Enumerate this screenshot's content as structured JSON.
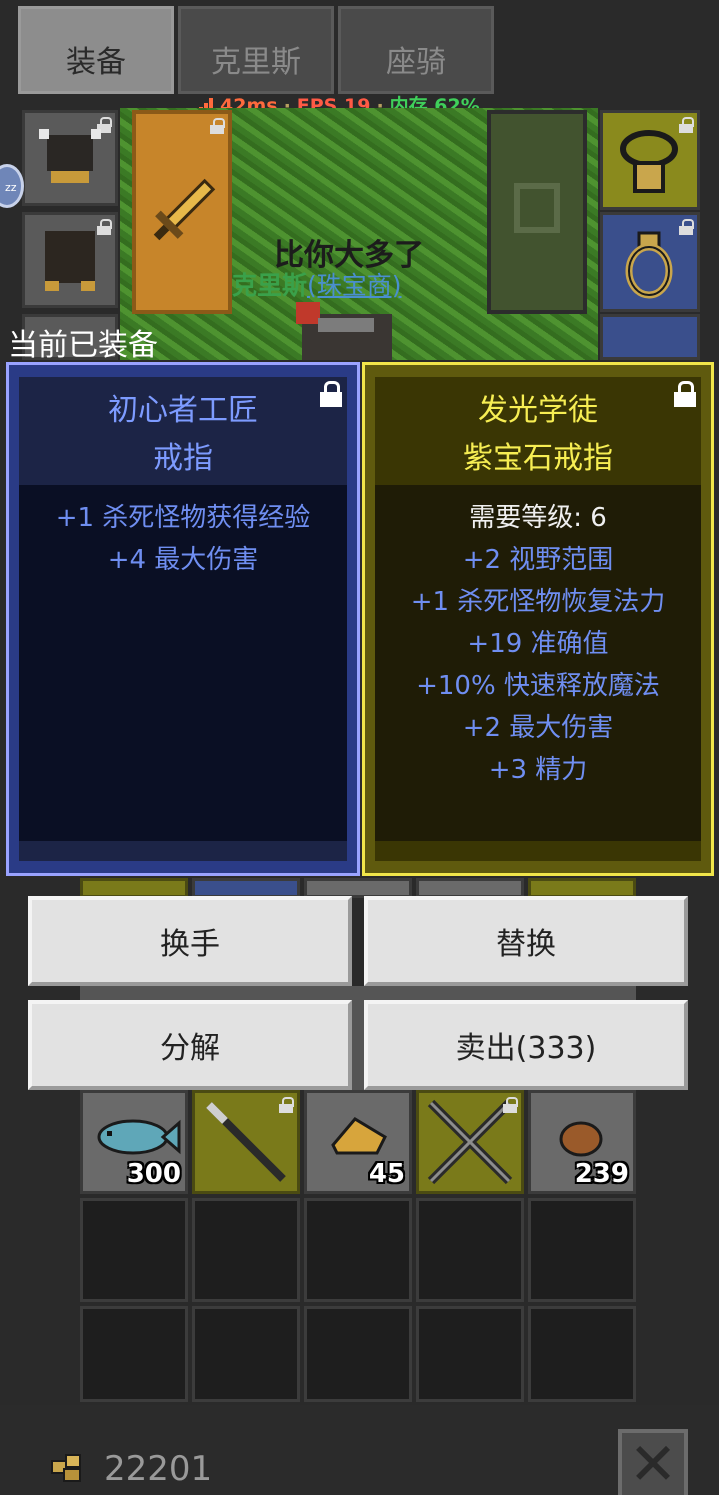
{
  "tabs": [
    {
      "label": "装备",
      "active": true
    },
    {
      "label": "克里斯",
      "active": false
    },
    {
      "label": "座骑",
      "active": false
    }
  ],
  "perf": {
    "ping": "42ms",
    "fps": "FPS 19",
    "mem": "内存 62%"
  },
  "scene": {
    "chat_bubble": "比你大多了",
    "player_name": "克里斯",
    "player_title": "(珠宝商)",
    "status_badge": "zz"
  },
  "equipped_label": "当前已装备",
  "current_item": {
    "name_line1": "初心者工匠",
    "name_line2": "戒指",
    "stats": [
      "+1 杀死怪物获得经验",
      "+4 最大伤害"
    ]
  },
  "new_item": {
    "name_line1": "发光学徒",
    "name_line2": "紫宝石戒指",
    "requirement": "需要等级: 6",
    "stats": [
      "+2 视野范围",
      "+1 杀死怪物恢复法力",
      "+19 准确值",
      "+10% 快速释放魔法",
      "+2 最大伤害",
      "+3 精力"
    ]
  },
  "actions": {
    "swap_hand": "换手",
    "replace": "替换",
    "salvage": "分解",
    "sell": "卖出(333)"
  },
  "inventory": {
    "row1": [
      {
        "icon": "fish-icon",
        "count": "300"
      },
      {
        "icon": "spear-icon",
        "count": ""
      },
      {
        "icon": "ore-icon",
        "count": "45"
      },
      {
        "icon": "crossed-swords-icon",
        "count": ""
      },
      {
        "icon": "meat-icon",
        "count": "239"
      }
    ]
  },
  "footer": {
    "gold": "22201"
  },
  "colors": {
    "rare": "#f1e64a",
    "uncommon": "#9aa3ff",
    "stat": "#6f8ef1"
  }
}
